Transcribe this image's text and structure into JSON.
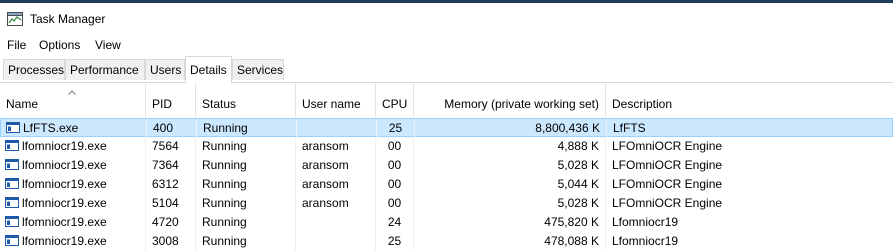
{
  "window": {
    "title": "Task Manager"
  },
  "menu": [
    {
      "label": "File"
    },
    {
      "label": "Options"
    },
    {
      "label": "View"
    }
  ],
  "tabs": [
    {
      "label": "Processes",
      "active": false
    },
    {
      "label": "Performance",
      "active": false
    },
    {
      "label": "Users",
      "active": false
    },
    {
      "label": "Details",
      "active": true
    },
    {
      "label": "Services",
      "active": false
    }
  ],
  "columns": {
    "name": "Name",
    "pid": "PID",
    "status": "Status",
    "user": "User name",
    "cpu": "CPU",
    "memory": "Memory (private working set)",
    "description": "Description"
  },
  "rows": [
    {
      "name": "LfFTS.exe",
      "pid": "400",
      "status": "Running",
      "user": "",
      "cpu": "25",
      "memory": "8,800,436 K",
      "description": "LfFTS",
      "selected": true
    },
    {
      "name": "lfomniocr19.exe",
      "pid": "7564",
      "status": "Running",
      "user": "aransom",
      "cpu": "00",
      "memory": "4,888 K",
      "description": "LFOmniOCR Engine",
      "selected": false
    },
    {
      "name": "lfomniocr19.exe",
      "pid": "7364",
      "status": "Running",
      "user": "aransom",
      "cpu": "00",
      "memory": "5,028 K",
      "description": "LFOmniOCR Engine",
      "selected": false
    },
    {
      "name": "lfomniocr19.exe",
      "pid": "6312",
      "status": "Running",
      "user": "aransom",
      "cpu": "00",
      "memory": "5,044 K",
      "description": "LFOmniOCR Engine",
      "selected": false
    },
    {
      "name": "lfomniocr19.exe",
      "pid": "5104",
      "status": "Running",
      "user": "aransom",
      "cpu": "00",
      "memory": "5,028 K",
      "description": "LFOmniOCR Engine",
      "selected": false
    },
    {
      "name": "lfomniocr19.exe",
      "pid": "4720",
      "status": "Running",
      "user": "",
      "cpu": "24",
      "memory": "475,820 K",
      "description": "Lfomniocr19",
      "selected": false
    },
    {
      "name": "lfomniocr19.exe",
      "pid": "3008",
      "status": "Running",
      "user": "",
      "cpu": "25",
      "memory": "478,088 K",
      "description": "Lfomniocr19",
      "selected": false
    }
  ],
  "icons": {
    "app": "task-manager-icon",
    "process": "application-window-icon",
    "sort": "sort-ascending-icon"
  },
  "colors": {
    "selection_bg": "#cce8ff",
    "selection_border": "#99d1ff",
    "icon_blue": "#1e5aa8"
  }
}
